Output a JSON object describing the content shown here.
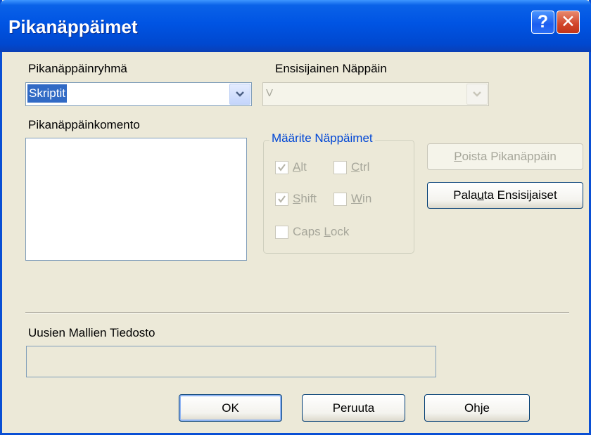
{
  "window": {
    "title": "Pikanäppäimet",
    "help_button": "?",
    "close_button": "✕"
  },
  "shortcut_group": {
    "label": "Pikanäppäinryhmä",
    "selected_value": "Skriptit"
  },
  "primary_key": {
    "label": "Ensisijainen Näppäin",
    "value": "V"
  },
  "command_list": {
    "label": "Pikanäppäinkomento",
    "items": []
  },
  "modifiers": {
    "legend": "Määrite Näppäimet",
    "alt": {
      "prefix": "",
      "accel": "A",
      "rest": "lt",
      "checked": true
    },
    "ctrl": {
      "prefix": "",
      "accel": "C",
      "rest": "trl",
      "checked": false
    },
    "shift": {
      "prefix": "",
      "accel": "S",
      "rest": "hift",
      "checked": true
    },
    "win": {
      "prefix": "",
      "accel": "W",
      "rest": "in",
      "checked": false
    },
    "capslock": {
      "prefix": "Caps ",
      "accel": "L",
      "rest": "ock",
      "checked": false
    }
  },
  "buttons": {
    "remove": {
      "prefix": "",
      "accel": "P",
      "rest": "oista Pikanäppäin"
    },
    "restore": {
      "prefix": "Pala",
      "accel": "u",
      "rest": "ta Ensisijaiset"
    },
    "ok": "OK",
    "cancel": "Peruuta",
    "help": "Ohje"
  },
  "new_templates": {
    "label": "Uusien Mallien Tiedosto",
    "value": ""
  },
  "colors": {
    "titlebar": "#0054e3",
    "dialog_bg": "#ece9d8",
    "selection": "#316ac5",
    "group_legend": "#0046d5",
    "disabled_text": "#a6a69a"
  }
}
